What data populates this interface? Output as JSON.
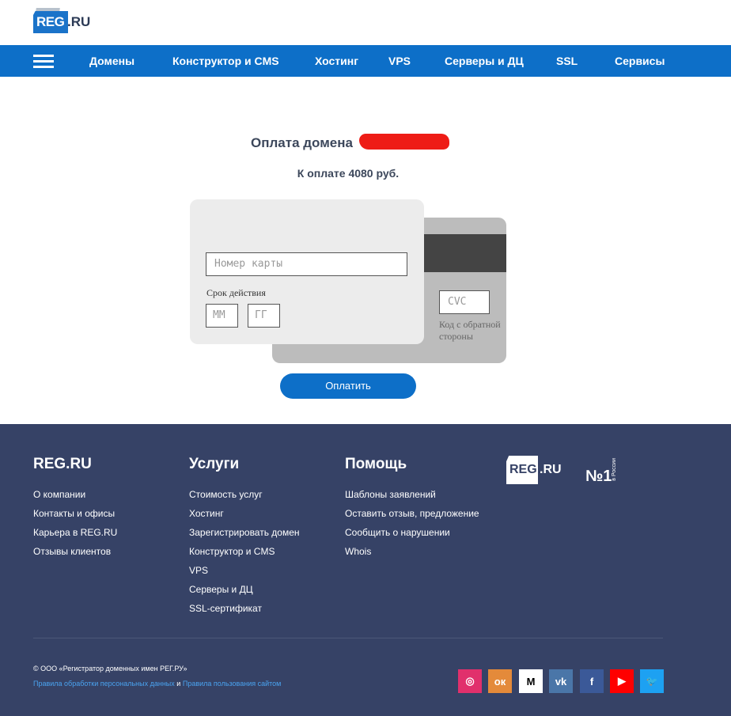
{
  "header": {
    "logo_text": "REG",
    "logo_suffix": ".RU"
  },
  "nav": {
    "menu_icon": "hamburger-menu-icon",
    "items": [
      "Домены",
      "Конструктор и CMS",
      "Хостинг",
      "VPS",
      "Серверы и ДЦ",
      "SSL",
      "Сервисы"
    ]
  },
  "payment": {
    "title": "Оплата домена",
    "amount": "К оплате 4080 руб.",
    "card_number_placeholder": "Номер карты",
    "expiry_label": "Срок действия",
    "month_placeholder": "ММ",
    "year_placeholder": "ГГ",
    "cvc_placeholder": "CVC",
    "cvc_hint": "Код с обратной стороны",
    "pay_button": "Оплатить"
  },
  "footer": {
    "col1": {
      "title": "REG.RU",
      "links": [
        "О компании",
        "Контакты и офисы",
        "Карьера в REG.RU",
        "Отзывы клиентов"
      ]
    },
    "col2": {
      "title": "Услуги",
      "links": [
        "Стоимость услуг",
        "Хостинг",
        "Зарегистрировать домен",
        "Конструктор и CMS",
        "VPS",
        "Серверы и ДЦ",
        "SSL-сертификат"
      ]
    },
    "col3": {
      "title": "Помощь",
      "links": [
        "Шаблоны заявлений",
        "Оставить отзыв, предложение",
        "Сообщить о нарушении",
        "Whois"
      ]
    },
    "logo_text": "REG",
    "logo_suffix": ".RU",
    "badge_number": "№1",
    "badge_text": "в России",
    "copyright": "© ООО «Регистратор доменных имен РЕГ.РУ»",
    "privacy_link": "Правила обработки персональных данных",
    "and": "и",
    "terms_link": "Правила пользования сайтом",
    "social": [
      {
        "icon": "instagram-icon",
        "glyph": "◎",
        "color": "#e1306c"
      },
      {
        "icon": "odnoklassniki-icon",
        "glyph": "ок",
        "color": "#e48a3a"
      },
      {
        "icon": "medium-icon",
        "glyph": "M",
        "color": "#ffffff"
      },
      {
        "icon": "vk-icon",
        "glyph": "vk",
        "color": "#4a76a8"
      },
      {
        "icon": "facebook-icon",
        "glyph": "f",
        "color": "#3b5998"
      },
      {
        "icon": "youtube-icon",
        "glyph": "▶",
        "color": "#ff0000"
      },
      {
        "icon": "twitter-icon",
        "glyph": "🐦",
        "color": "#1da1f2"
      }
    ]
  },
  "colors": {
    "brand_blue": "#0d6fc8",
    "footer_bg": "#364266",
    "redaction": "#ee1c16"
  }
}
